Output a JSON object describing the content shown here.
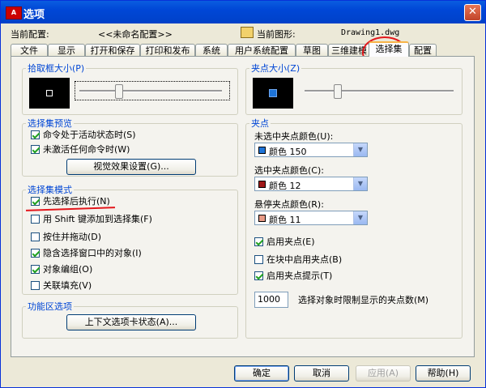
{
  "title": "选项",
  "app_icon_text": "A",
  "current_profile_label": "当前配置:",
  "current_profile_value": "<<未命名配置>>",
  "current_drawing_label": "当前图形:",
  "current_drawing_value": "Drawing1.dwg",
  "tabs": [
    "文件",
    "显示",
    "打开和保存",
    "打印和发布",
    "系统",
    "用户系统配置",
    "草图",
    "三维建模",
    "选择集",
    "配置"
  ],
  "pickbox": {
    "legend": "拾取框大小(P)"
  },
  "grip_size": {
    "legend": "夹点大小(Z)"
  },
  "preview": {
    "legend": "选择集预览",
    "items": [
      {
        "label": "命令处于活动状态时(S)",
        "checked": true
      },
      {
        "label": "未激活任何命令时(W)",
        "checked": true
      }
    ],
    "button": "视觉效果设置(G)..."
  },
  "modes": {
    "legend": "选择集模式",
    "items": [
      {
        "label": "先选择后执行(N)",
        "checked": true
      },
      {
        "label": "用 Shift 键添加到选择集(F)",
        "checked": false
      },
      {
        "label": "按住并拖动(D)",
        "checked": false
      },
      {
        "label": "隐含选择窗口中的对象(I)",
        "checked": true
      },
      {
        "label": "对象编组(O)",
        "checked": true
      },
      {
        "label": "关联填充(V)",
        "checked": false
      }
    ]
  },
  "ribbon": {
    "legend": "功能区选项",
    "button": "上下文选项卡状态(A)..."
  },
  "grips": {
    "legend": "夹点",
    "unselected_label": "未选中夹点颜色(U):",
    "unselected_value": "颜色 150",
    "selected_label": "选中夹点颜色(C):",
    "selected_value": "颜色 12",
    "hover_label": "悬停夹点颜色(R):",
    "hover_value": "颜色 11",
    "colors": {
      "unselected": "#1e74d8",
      "selected": "#a01818",
      "hover": "#e89a86"
    },
    "checks": [
      {
        "label": "启用夹点(E)",
        "checked": true
      },
      {
        "label": "在块中启用夹点(B)",
        "checked": false
      },
      {
        "label": "启用夹点提示(T)",
        "checked": true
      }
    ],
    "limit_value": "1000",
    "limit_label": "选择对象时限制显示的夹点数(M)"
  },
  "buttons": {
    "ok": "确定",
    "cancel": "取消",
    "apply": "应用(A)",
    "help": "帮助(H)"
  },
  "close_glyph": "✕"
}
